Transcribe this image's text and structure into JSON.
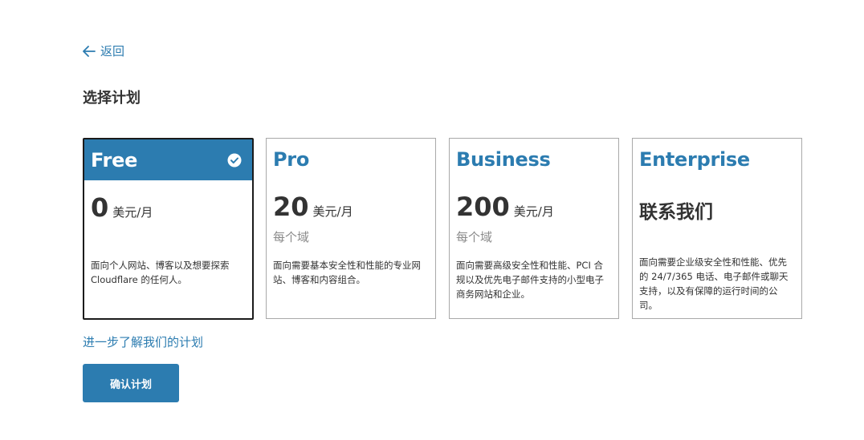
{
  "nav": {
    "back_label": "返回"
  },
  "page": {
    "title": "选择计划"
  },
  "plans": [
    {
      "name": "Free",
      "price": "0",
      "unit": "美元/月",
      "per": "",
      "description": "面向个人网站、博客以及想要探索 Cloudflare 的任何人。",
      "selected": true
    },
    {
      "name": "Pro",
      "price": "20",
      "unit": "美元/月",
      "per": "每个域",
      "description": "面向需要基本安全性和性能的专业网站、博客和内容组合。",
      "selected": false
    },
    {
      "name": "Business",
      "price": "200",
      "unit": "美元/月",
      "per": "每个域",
      "description": "面向需要高级安全性和性能、PCI 合规以及优先电子邮件支持的小型电子商务网站和企业。",
      "selected": false
    },
    {
      "name": "Enterprise",
      "price": "联系我们",
      "unit": "",
      "per": "",
      "description": "面向需要企业级安全性和性能、优先的 24/7/365 电话、电子邮件或聊天支持，以及有保障的运行时间的公司。",
      "selected": false
    }
  ],
  "footer": {
    "learn_more": "进一步了解我们的计划",
    "confirm_label": "确认计划"
  },
  "colors": {
    "accent": "#2c7cb0",
    "text": "#333333",
    "muted": "#8a8a8a",
    "border": "#a9a9a9"
  },
  "icons": {
    "back": "arrow-left-icon",
    "selected": "check-circle-icon"
  }
}
